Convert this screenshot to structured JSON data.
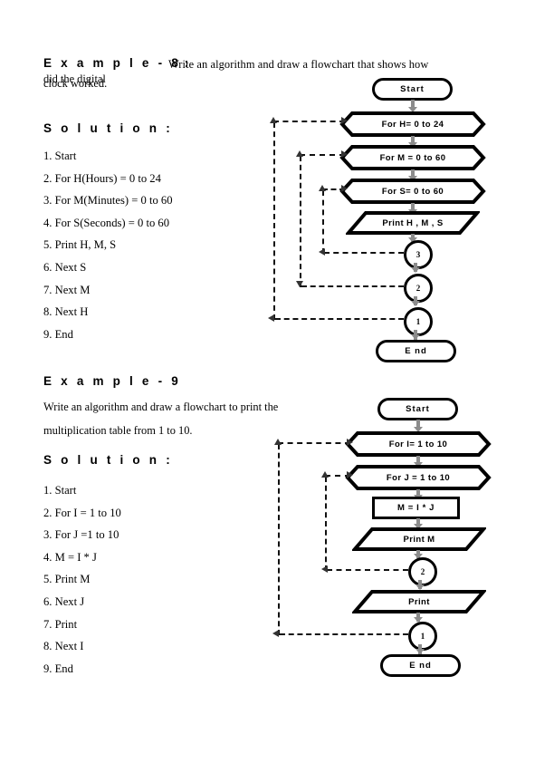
{
  "document": {
    "sections": [
      {
        "id": "example-8",
        "heading": "E x a m p l e - 8",
        "heading_colon": " :",
        "prompt_line1": "Write an algorithm and draw a flowchart that  shows how",
        "prompt_line2": "did the digital",
        "prompt_line3": "clock worked.",
        "solution_heading": "S o l u t i o n :",
        "algorithm": [
          "1. Start",
          "2. For H(Hours) = 0 to 24",
          "3. For M(Minutes) = 0 to 60",
          "4. For S(Seconds) = 0 to 60",
          "5. Print H, M, S",
          "6. Next S",
          "7. Next M",
          "8. Next H",
          "9. End"
        ],
        "flowchart": {
          "start": "Start",
          "loop_h": "For H= 0 to 24",
          "loop_m": "For M = 0 to 60",
          "loop_s": "For S= 0 to 60",
          "print": "Print H , M , S",
          "connector_3": "3",
          "connector_2": "2",
          "connector_1": "1",
          "end": "E nd"
        }
      },
      {
        "id": "example-9",
        "heading": "E x a m p l e - 9",
        "prompt_line1": "Write   an   algorithm   and   draw   a   flowchart   to   print   the",
        "prompt_line2": "multiplication table from 1 to 10.",
        "solution_heading": "S o l u t i o n :",
        "algorithm": [
          "1. Start",
          "2. For I = 1 to 10",
          "3. For J =1 to 10",
          "4. M = I * J",
          "5. Print M",
          "6. Next J",
          "7. Print",
          "8. Next I",
          "9. End"
        ],
        "flowchart": {
          "start": "Start",
          "loop_i": "For I= 1 to 10",
          "loop_j": "For J = 1 to 10",
          "assign": "M = I * J",
          "print_m": "Print M",
          "connector_2": "2",
          "print": "Print",
          "connector_1": "1",
          "end": "E nd"
        }
      }
    ]
  },
  "colors": {
    "ink": "#000000",
    "arrow_grey": "#8c8c8c",
    "dash": "#111111",
    "page": "#ffffff"
  }
}
